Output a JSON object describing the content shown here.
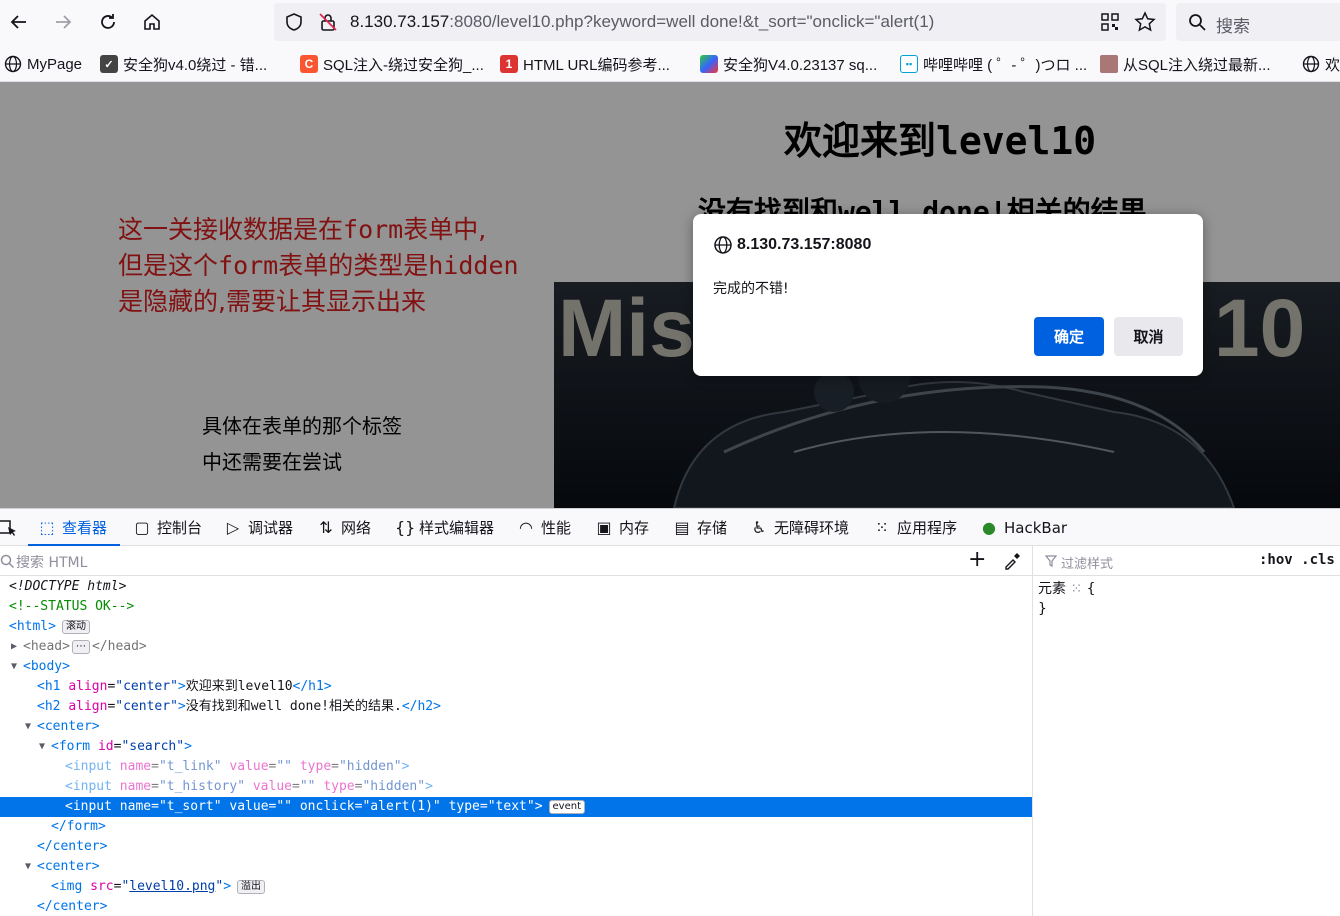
{
  "browser": {
    "url": {
      "host": "8.130.73.157",
      "rest": ":8080/level10.php?keyword=well done!&t_sort=\"onclick=\"alert(1)"
    },
    "search_placeholder": "搜索",
    "bookmarks": [
      {
        "label": "MyPage",
        "icon": "globe-icon"
      },
      {
        "label": "安全狗v4.0绕过 - 错...",
        "icon": "site-icon"
      },
      {
        "label": "SQL注入-绕过安全狗_...",
        "icon": "csdn-icon"
      },
      {
        "label": "HTML URL编码参考...",
        "icon": "one-icon"
      },
      {
        "label": "安全狗V4.0.23137 sq...",
        "icon": "site-icon"
      },
      {
        "label": "哔哩哔哩 ( ゜- ゜)つロ ...",
        "icon": "bilibili-icon"
      },
      {
        "label": "从SQL注入绕过最新...",
        "icon": "avatar-icon"
      },
      {
        "label": "欢",
        "icon": "globe-icon"
      }
    ]
  },
  "page": {
    "h1_prefix": "欢迎来到",
    "h1_mono": "level10",
    "h2_a": "没有找到和",
    "h2_mono": "well done!",
    "h2_b": "相关的结果",
    "note_red": {
      "l1a": "这一关接收数据是在",
      "l1m": "form",
      "l1b": "表单中,",
      "l2a": "但是这个",
      "l2m": "form",
      "l2b": "表单的类型是",
      "l2m2": "hidden",
      "l3": "是隐藏的,需要让其显示出来"
    },
    "note_black_1": "具体在表单的那个标签",
    "note_black_2": "中还需要在尝试",
    "image_text": "Mis",
    "image_text2": "10"
  },
  "dialog": {
    "origin": "8.130.73.157:8080",
    "message": "完成的不错!",
    "ok": "确定",
    "cancel": "取消"
  },
  "devtools": {
    "tabs": [
      "查看器",
      "控制台",
      "调试器",
      "网络",
      "样式编辑器",
      "性能",
      "内存",
      "存储",
      "无障碍环境",
      "应用程序",
      "HackBar"
    ],
    "search_placeholder": "搜索 HTML",
    "filter_placeholder": "过滤样式",
    "hov_cls": ":hov .cls",
    "rules_selector": "元素",
    "rules_open": "{",
    "rules_close": "}",
    "badges": {
      "scroll": "滚动",
      "event": "event",
      "overflow": "溢出"
    },
    "tree": {
      "doctype": "<!DOCTYPE html>",
      "comment": "<!--STATUS OK-->",
      "h1_text": "欢迎来到level10",
      "h2_text": "没有找到和well done!相关的结果.",
      "img_src": "level10.png"
    }
  }
}
